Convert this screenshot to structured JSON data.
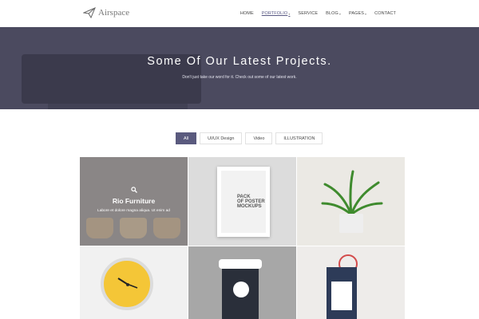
{
  "brand": {
    "name": "Airspace"
  },
  "nav": {
    "items": [
      {
        "label": "HOME",
        "has_caret": false,
        "active": false
      },
      {
        "label": "PORTFOLIO",
        "has_caret": true,
        "active": true
      },
      {
        "label": "SERVICE",
        "has_caret": false,
        "active": false
      },
      {
        "label": "BLOG",
        "has_caret": true,
        "active": false
      },
      {
        "label": "PAGES",
        "has_caret": true,
        "active": false
      },
      {
        "label": "CONTACT",
        "has_caret": false,
        "active": false
      }
    ]
  },
  "hero": {
    "title": "Some Of Our Latest Projects.",
    "subtitle": "Don't just take our word for it. Check out some of our latest work."
  },
  "filters": [
    {
      "label": "All",
      "active": true
    },
    {
      "label": "UI/UX Design",
      "active": false
    },
    {
      "label": "Video",
      "active": false
    },
    {
      "label": "ILLUSTRATION",
      "active": false
    }
  ],
  "portfolio": {
    "featured": {
      "title": "Rio Furniture",
      "description": "Labore et dolore magna aliqua. Ut enim ad"
    },
    "poster_text": [
      "PACK",
      "OF POSTER",
      "MOCKUPS"
    ]
  },
  "colors": {
    "hero_bg": "#4b4a5f",
    "accent": "#5a5a7e",
    "nav_active": "#5a5a84"
  }
}
